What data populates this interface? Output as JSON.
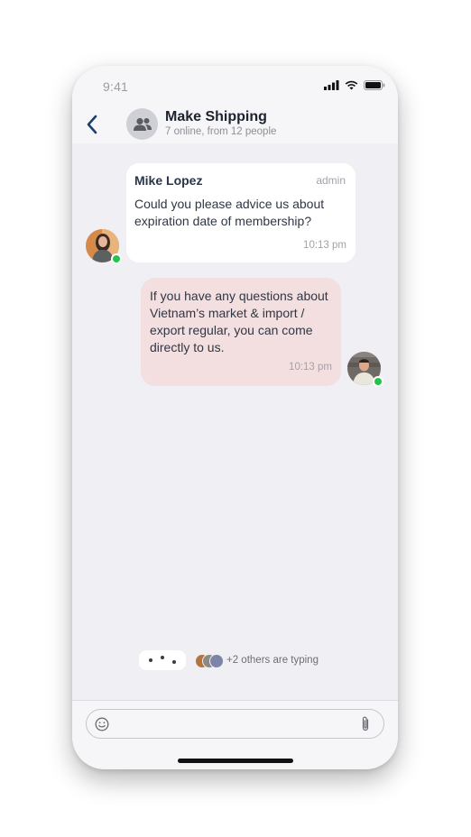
{
  "status_bar": {
    "time": "9:41"
  },
  "header": {
    "back_icon": "chevron-left-icon",
    "group_icon": "group-icon",
    "title": "Make Shipping",
    "subtitle": "7 online, from 12 people"
  },
  "messages": [
    {
      "direction": "incoming",
      "sender": "Mike Lopez",
      "role": "admin",
      "text": "Could you please advice us about expiration date of membership?",
      "time": "10:13 pm",
      "online": true
    },
    {
      "direction": "outgoing",
      "text": "If you have any questions about Vietnam’s market & import / export regular, you can come directly to us.",
      "time": "10:13 pm",
      "online": true
    }
  ],
  "typing": {
    "text": "+2 others are typing"
  },
  "composer": {
    "emoji_icon": "emoji-icon",
    "attach_icon": "paperclip-icon",
    "placeholder": ""
  },
  "colors": {
    "incoming_bubble": "#ffffff",
    "outgoing_bubble": "#f4dfe0",
    "online": "#27c24c",
    "accent": "#1d3f6e"
  }
}
